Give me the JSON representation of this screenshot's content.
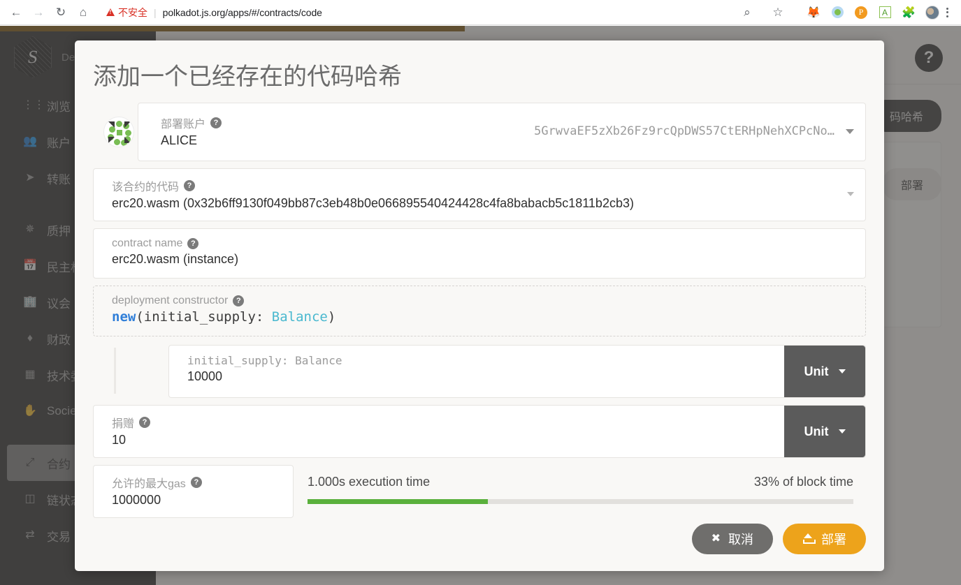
{
  "browser": {
    "back_icon": "back-arrow-icon",
    "forward_icon": "forward-arrow-icon",
    "reload_icon": "reload-icon",
    "home_icon": "home-icon",
    "security_warning": "不安全",
    "url": "polkadot.js.org/apps/#/contracts/code",
    "zoom_icon": "zoom-search-icon",
    "bookmark_icon": "star-icon",
    "extensions": [
      "metamask-fox-icon",
      "polkadot-extension-icon",
      "pocket-icon",
      "grammarly-a-icon",
      "puzzle-extensions-icon"
    ],
    "profile_icon": "profile-avatar",
    "menu_icon": "kebab-menu-icon"
  },
  "sidebar": {
    "brand": "De",
    "logo_icon": "substrate-hex-logo",
    "items": [
      {
        "icon": "grid-dots-icon",
        "label": "浏览",
        "active": false
      },
      {
        "icon": "users-icon",
        "label": "账户",
        "active": false
      },
      {
        "icon": "paper-plane-icon",
        "label": "转账",
        "active": false
      },
      {
        "icon": "gear-star-icon",
        "label": "质押",
        "active": false
      },
      {
        "icon": "calendar-check-icon",
        "label": "民主权",
        "active": false
      },
      {
        "icon": "building-icon",
        "label": "议会",
        "active": false
      },
      {
        "icon": "gem-icon",
        "label": "财政",
        "active": false
      },
      {
        "icon": "chip-icon",
        "label": "技术委",
        "active": false
      },
      {
        "icon": "hand-icon",
        "label": "Societ",
        "active": false
      },
      {
        "icon": "contract-icon",
        "label": "合约",
        "active": true
      },
      {
        "icon": "database-icon",
        "label": "链状态",
        "active": false
      },
      {
        "icon": "exchange-icon",
        "label": "交易",
        "active": false
      }
    ]
  },
  "main": {
    "help_icon": "question-mark-help-icon",
    "add_code_hash_button": "码哈希",
    "deploy_ghost_button": "部署"
  },
  "modal": {
    "title": "添加一个已经存在的代码哈希",
    "help_icon": "question-mark-icon",
    "fields": {
      "account": {
        "label": "部署账户",
        "value": "ALICE",
        "address": "5GrwvaEF5zXb26Fz9rcQpDWS57CtERHpNehXCPcNo…",
        "identicon": "polkadot-identicon"
      },
      "code": {
        "label": "该合约的代码",
        "value": "erc20.wasm (0x32b6ff9130f049bb87c3eb48b0e066895540424428c4fa8babacb5c1811b2cb3)"
      },
      "contract_name": {
        "label": "contract name",
        "value": "erc20.wasm (instance)"
      },
      "constructor": {
        "label": "deployment constructor",
        "code_keyword": "new",
        "code_open": "(initial_supply: ",
        "code_type": "Balance",
        "code_close": ")"
      },
      "initial_supply": {
        "label": "initial_supply: Balance",
        "value": "10000",
        "unit": "Unit"
      },
      "endowment": {
        "label": "捐赠",
        "value": "10",
        "unit": "Unit"
      },
      "max_gas": {
        "label": "允许的最大gas",
        "value": "1000000"
      }
    },
    "gas_meter": {
      "execution_time": "1.000s execution time",
      "block_time_percent": "33% of block time",
      "fill_percent": 33,
      "fill_color": "#5ab03c"
    },
    "footer": {
      "cancel_label": "取消",
      "cancel_icon": "close-x-icon",
      "deploy_label": "部署",
      "deploy_icon": "upload-icon",
      "deploy_color": "#eda31b"
    }
  }
}
